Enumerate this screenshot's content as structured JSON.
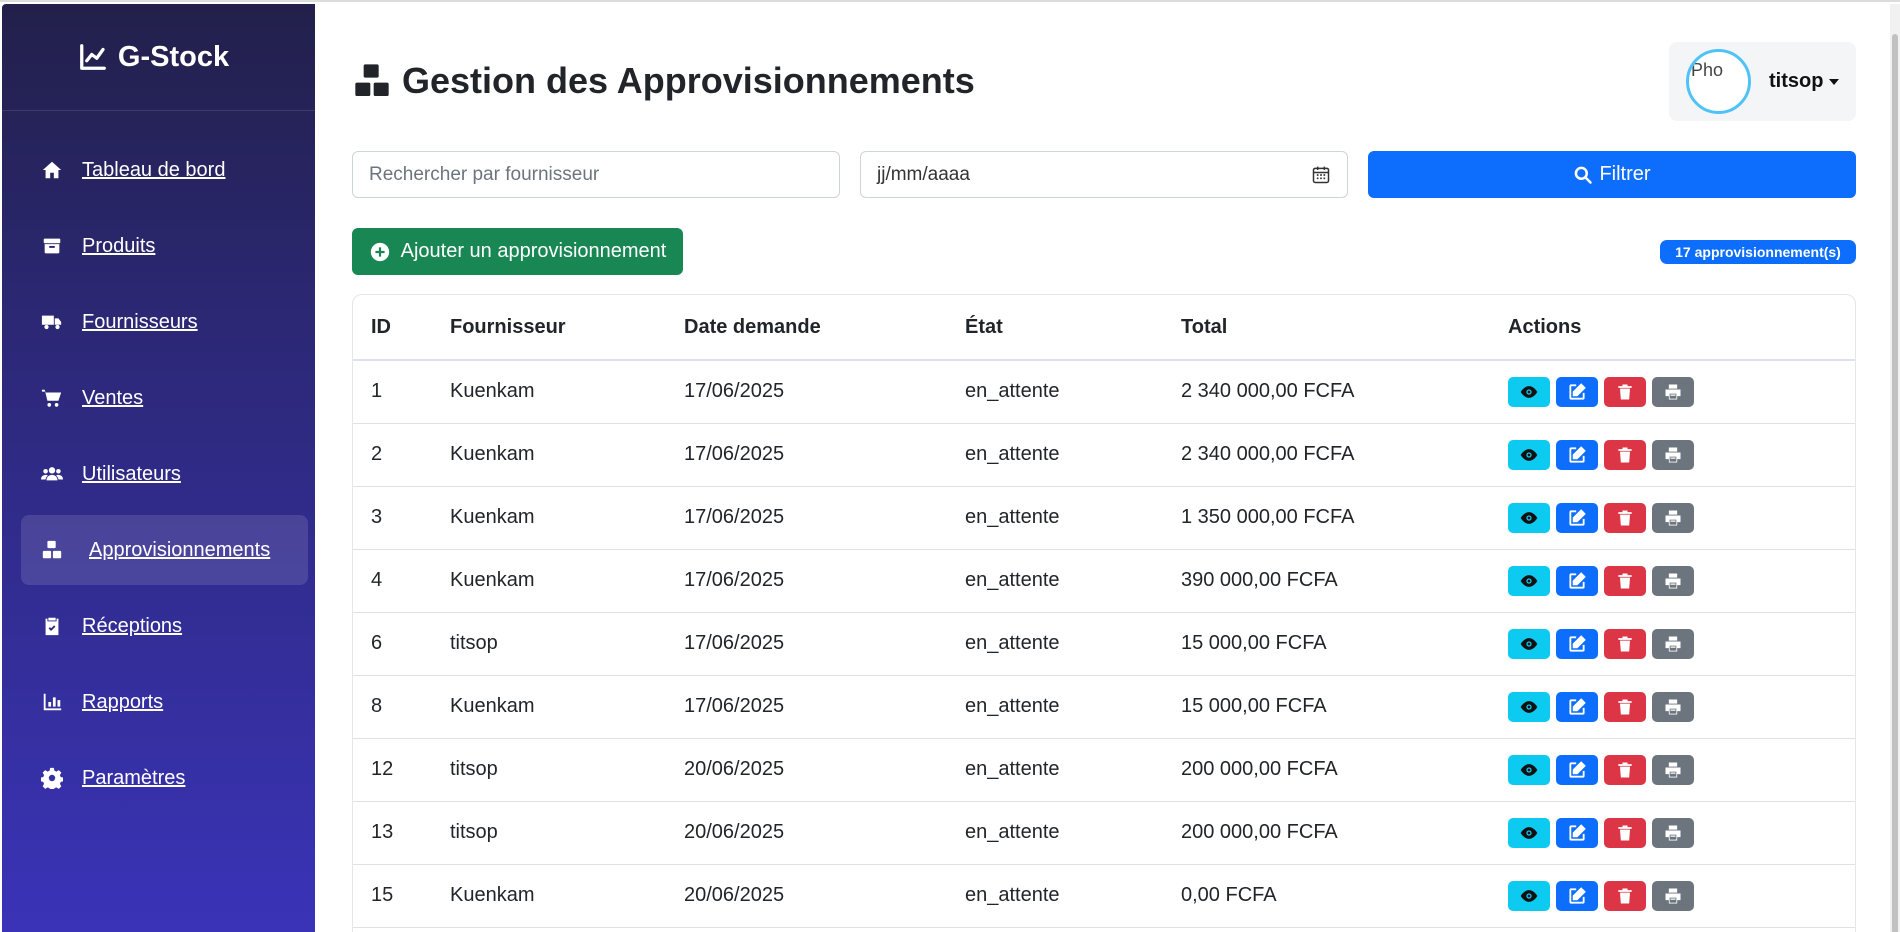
{
  "app": {
    "brand": "G-Stock"
  },
  "sidebar": {
    "items": [
      {
        "label": "Tableau de bord",
        "icon": "home-icon"
      },
      {
        "label": "Produits",
        "icon": "box-icon"
      },
      {
        "label": "Fournisseurs",
        "icon": "truck-icon"
      },
      {
        "label": "Ventes",
        "icon": "cart-icon"
      },
      {
        "label": "Utilisateurs",
        "icon": "users-icon"
      },
      {
        "label": "Approvisionnements",
        "icon": "boxes-icon",
        "active": true
      },
      {
        "label": "Réceptions",
        "icon": "clipboard-check-icon"
      },
      {
        "label": "Rapports",
        "icon": "bar-chart-icon"
      },
      {
        "label": "Paramètres",
        "icon": "gear-icon"
      }
    ]
  },
  "header": {
    "title": "Gestion des Approvisionnements",
    "user": {
      "name": "titsop",
      "avatar_alt": "Pho"
    }
  },
  "filters": {
    "search_placeholder": "Rechercher par fournisseur",
    "date_placeholder": "jj/mm/aaaa",
    "filter_label": "Filtrer"
  },
  "actions": {
    "add_label": "Ajouter un approvisionnement",
    "count_badge": "17 approvisionnement(s)"
  },
  "table": {
    "headers": {
      "id": "ID",
      "fournisseur": "Fournisseur",
      "date": "Date demande",
      "etat": "État",
      "total": "Total",
      "actions": "Actions"
    },
    "rows": [
      {
        "id": "1",
        "fournisseur": "Kuenkam",
        "date": "17/06/2025",
        "etat": "en_attente",
        "total": "2 340 000,00 FCFA"
      },
      {
        "id": "2",
        "fournisseur": "Kuenkam",
        "date": "17/06/2025",
        "etat": "en_attente",
        "total": "2 340 000,00 FCFA"
      },
      {
        "id": "3",
        "fournisseur": "Kuenkam",
        "date": "17/06/2025",
        "etat": "en_attente",
        "total": "1 350 000,00 FCFA"
      },
      {
        "id": "4",
        "fournisseur": "Kuenkam",
        "date": "17/06/2025",
        "etat": "en_attente",
        "total": "390 000,00 FCFA"
      },
      {
        "id": "6",
        "fournisseur": "titsop",
        "date": "17/06/2025",
        "etat": "en_attente",
        "total": "15 000,00 FCFA"
      },
      {
        "id": "8",
        "fournisseur": "Kuenkam",
        "date": "17/06/2025",
        "etat": "en_attente",
        "total": "15 000,00 FCFA"
      },
      {
        "id": "12",
        "fournisseur": "titsop",
        "date": "20/06/2025",
        "etat": "en_attente",
        "total": "200 000,00 FCFA"
      },
      {
        "id": "13",
        "fournisseur": "titsop",
        "date": "20/06/2025",
        "etat": "en_attente",
        "total": "200 000,00 FCFA"
      },
      {
        "id": "15",
        "fournisseur": "Kuenkam",
        "date": "20/06/2025",
        "etat": "en_attente",
        "total": "0,00 FCFA"
      }
    ]
  },
  "colors": {
    "primary": "#0d6efd",
    "success": "#198754",
    "info": "#0dcaf0",
    "danger": "#dc3545",
    "secondary": "#6c757d"
  }
}
